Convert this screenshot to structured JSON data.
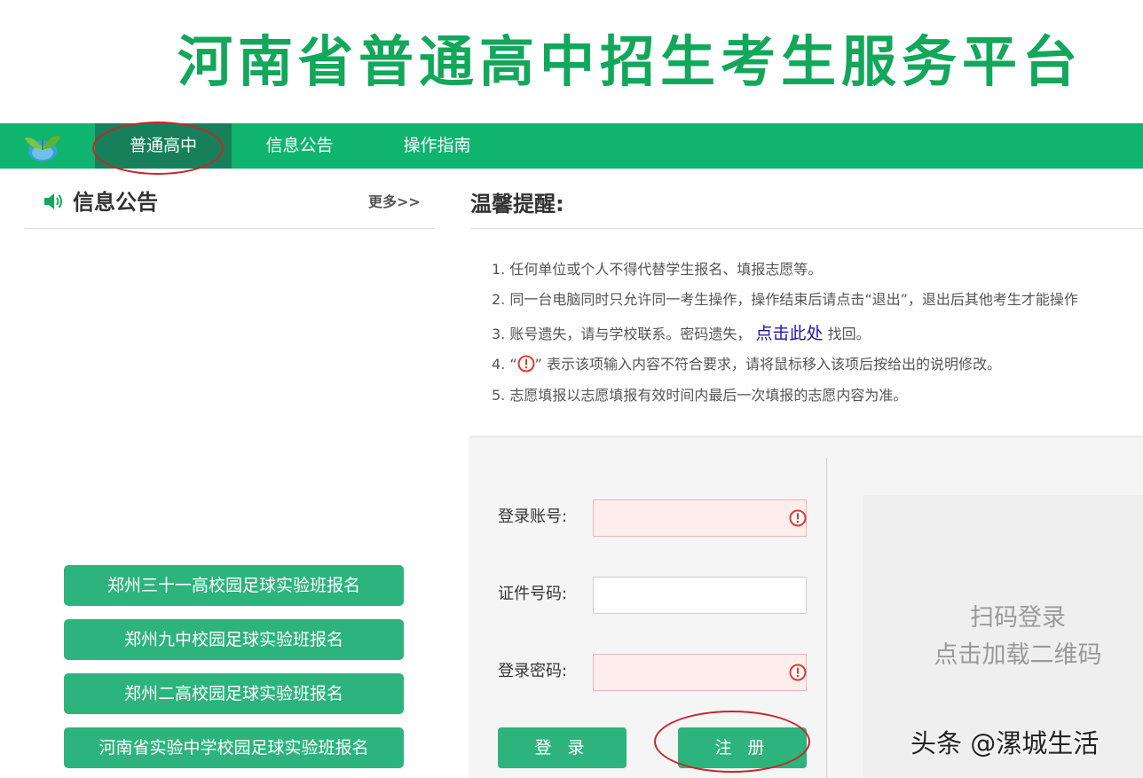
{
  "header": {
    "title": "河南省普通高中招生考生服务平台"
  },
  "nav": {
    "items": [
      {
        "label": "普通高中",
        "active": true
      },
      {
        "label": "信息公告",
        "active": false
      },
      {
        "label": "操作指南",
        "active": false
      }
    ]
  },
  "announcements": {
    "title": "信息公告",
    "more": "更多>>",
    "buttons": [
      "郑州三十一高校园足球实验班报名",
      "郑州九中校园足球实验班报名",
      "郑州二高校园足球实验班报名",
      "河南省实验中学校园足球实验班报名"
    ]
  },
  "tips": {
    "title": "温馨提醒:",
    "item1": "1. 任何单位或个人不得代替学生报名、填报志愿等。",
    "item2": "2. 同一台电脑同时只允许同一考生操作，操作结束后请点击“退出”，退出后其他考生才能操作",
    "item3_pre": "3. 账号遗失，请与学校联系。密码遗失，",
    "item3_link": "点击此处",
    "item3_post": "找回。",
    "item4_pre": "4. “",
    "item4_post": "” 表示该项输入内容不符合要求，请将鼠标移入该项后按给出的说明修改。",
    "item5": "5. 志愿填报以志愿填报有效时间内最后一次填报的志愿内容为准。"
  },
  "login": {
    "account_label": "登录账号:",
    "account_value": "",
    "id_label": "证件号码:",
    "id_value": "",
    "password_label": "登录密码:",
    "password_value": "",
    "login_button": "登 录",
    "register_button": "注 册"
  },
  "qr": {
    "line1": "扫码登录",
    "line2": "点击加载二维码"
  },
  "watermark": "头条 @漯城生活",
  "colors": {
    "brand_green": "#0fb46f",
    "title_green": "#12a75a",
    "button_green": "#2db47c",
    "nav_active": "#17805a",
    "annotation_red": "#c9252c",
    "link_blue": "#1a1aa6"
  }
}
